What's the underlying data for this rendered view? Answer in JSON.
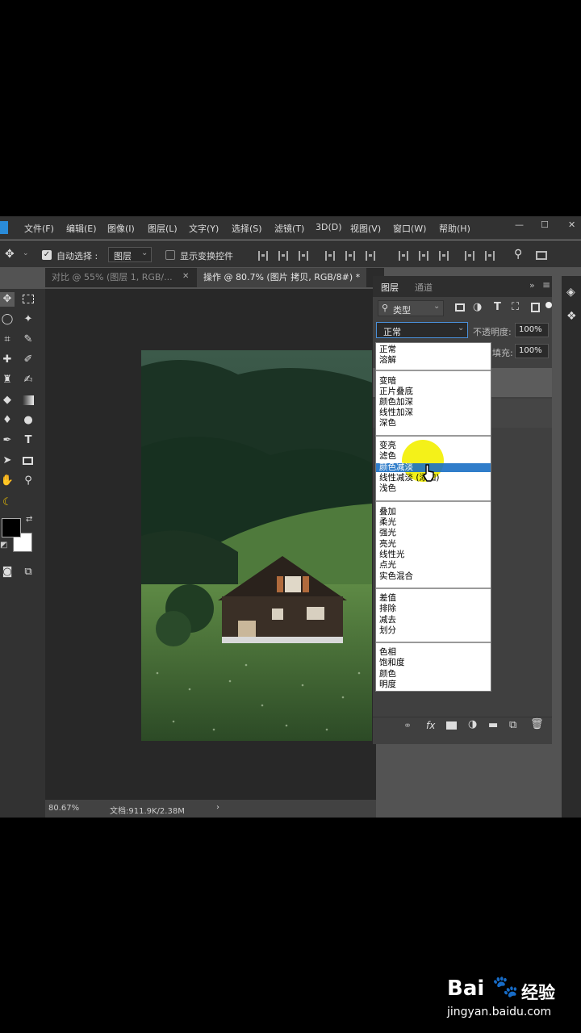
{
  "menubar": {
    "items": [
      "文件(F)",
      "编辑(E)",
      "图像(I)",
      "图层(L)",
      "文字(Y)",
      "选择(S)",
      "滤镜(T)",
      "3D(D)",
      "视图(V)",
      "窗口(W)",
      "帮助(H)"
    ]
  },
  "options": {
    "auto_select_label": "自动选择 :",
    "auto_select_value": "图层",
    "show_transform_label": "显示变换控件"
  },
  "tabs": [
    {
      "label": "对比 @ 55% (图层 1, RGB/..."
    },
    {
      "label": "操作 @ 80.7% (图片 拷贝, RGB/8#) *"
    }
  ],
  "status": {
    "zoom": "80.67%",
    "doc": "文档:911.9K/2.38M",
    "arrow": "›"
  },
  "layers_panel": {
    "tab_layers": "图层",
    "tab_channels": "通道",
    "filter_type": "类型",
    "blend_mode": "正常",
    "opacity_label": "不透明度:",
    "opacity_value": "100%",
    "fill_label": "填充:",
    "fill_value": "100%"
  },
  "blend_groups": [
    {
      "items": [
        "正常",
        "溶解"
      ]
    },
    {
      "items": [
        "变暗",
        "正片叠底",
        "颜色加深",
        "线性加深",
        "深色"
      ]
    },
    {
      "items": [
        "变亮",
        "滤色",
        "颜色减淡",
        "线性减淡 (添加)",
        "浅色"
      ]
    },
    {
      "items": [
        "叠加",
        "柔光",
        "强光",
        "亮光",
        "线性光",
        "点光",
        "实色混合"
      ]
    },
    {
      "items": [
        "差值",
        "排除",
        "减去",
        "划分"
      ]
    },
    {
      "items": [
        "色相",
        "饱和度",
        "颜色",
        "明度"
      ]
    }
  ],
  "highlighted_option": "颜色减淡",
  "watermark": {
    "brand": "Bai",
    "brand2": "经验",
    "url": "jingyan.baidu.com"
  },
  "colors": {
    "highlight": "#1a6fc4",
    "cursor_spot": "#f3f000"
  }
}
